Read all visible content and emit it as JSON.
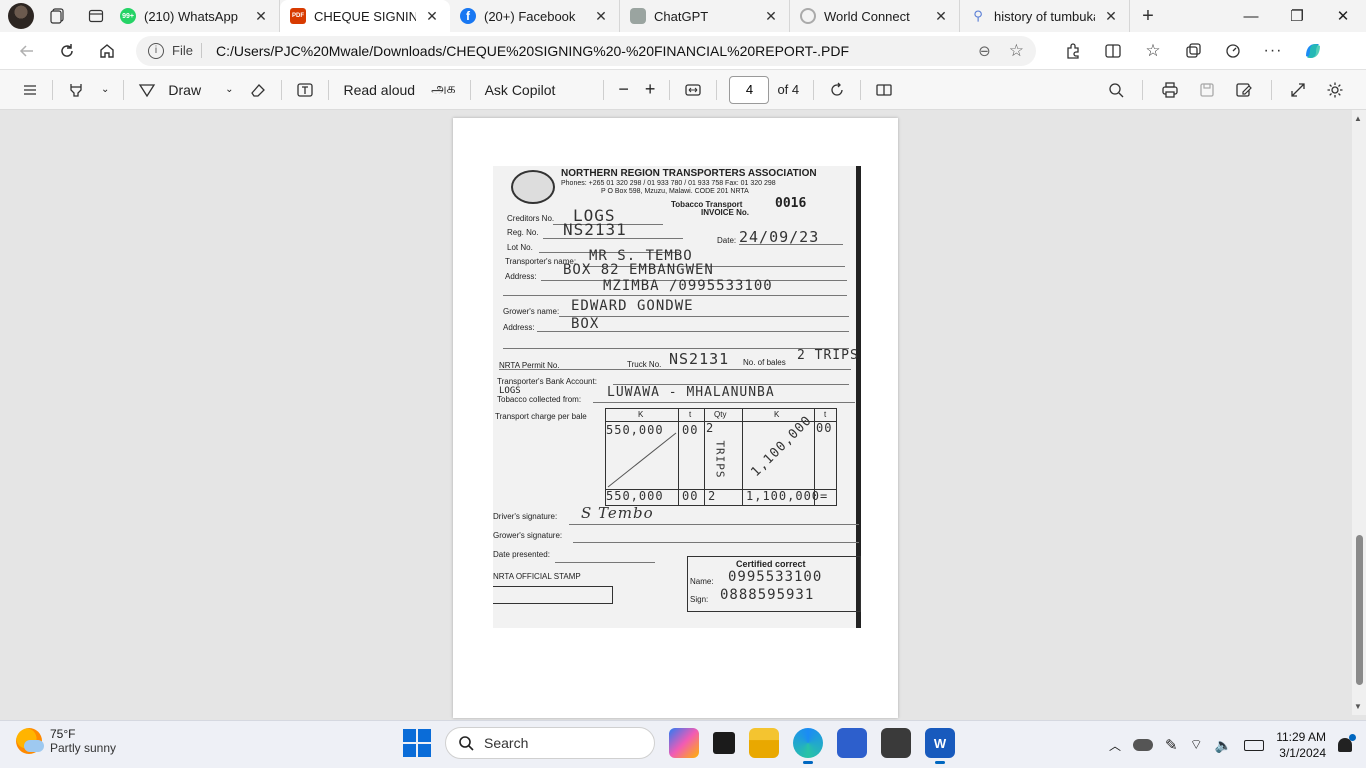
{
  "tabs": [
    {
      "title": "(210) WhatsApp",
      "favicon_text": "99+",
      "favicon_color": "#25d366",
      "active": false
    },
    {
      "title": "CHEQUE SIGNING -",
      "favicon_text": "PDF",
      "favicon_color": "#d83b01",
      "active": true
    },
    {
      "title": "(20+) Facebook",
      "favicon_text": "f",
      "favicon_color": "#1877f2",
      "active": false
    },
    {
      "title": "ChatGPT",
      "favicon_text": "",
      "favicon_color": "#9aa4a0",
      "active": false
    },
    {
      "title": "World Connect",
      "favicon_text": "",
      "favicon_color": "#cccccc",
      "active": false
    },
    {
      "title": "history of tumbukas",
      "favicon_text": "",
      "favicon_color": "#5b7fd6",
      "active": false
    }
  ],
  "address": {
    "file_label": "File",
    "url": "C:/Users/PJC%20Mwale/Downloads/CHEQUE%20SIGNING%20-%20FINANCIAL%20REPORT-.PDF"
  },
  "pdf_toolbar": {
    "draw_label": "Draw",
    "read_aloud_label": "Read aloud",
    "translate_label": "அக",
    "ask_copilot_label": "Ask Copilot",
    "current_page": "4",
    "total_pages_label": "of 4"
  },
  "document": {
    "org_name": "NORTHERN REGION TRANSPORTERS ASSOCIATION",
    "phones": "Phones: +265 01 320 298 / 01 933 780 / 01 933 758  Fax: 01 320 298",
    "po_box": "P O Box 598, Mzuzu, Malawi. CODE 201 NRTA",
    "invoice_title": "Tobacco Transport",
    "invoice_label": "INVOICE No.",
    "invoice_no": "0016",
    "creditors_label": "Creditors No.",
    "creditors_value": "LOGS",
    "reg_label": "Reg. No.",
    "reg_value": "NS2131",
    "lot_label": "Lot No.",
    "date_label": "Date:",
    "date_value": "24/09/23",
    "transporter_label": "Transporter's name:",
    "transporter_value": "MR  S.   TEMBO",
    "address_label": "Address:",
    "address_line1": "BOX 82  EMBANGWEN",
    "address_line2": "MZIMBA  /0995533100",
    "grower_label": "Grower's name:",
    "grower_value": "EDWARD  GONDWE",
    "grower_address_label": "Address:",
    "grower_address_value": "BOX",
    "permit_label": "NRTA Permit No.",
    "truck_label": "Truck No.",
    "truck_value": "NS2131",
    "bales_label": "No. of bales",
    "bales_value": "2 TRIPS",
    "bank_label": "Transporter's Bank Account:",
    "bank_value": "LOGS",
    "collected_label": "Tobacco collected from:",
    "collected_value": "LUWAWA  -  MHALANUNBA",
    "charge_label": "Transport charge per bale",
    "col_k": "K",
    "col_t": "t",
    "col_qty": "Qty",
    "col_k2": "K",
    "col_t2": "t",
    "row_k": "550,000",
    "row_t": "00",
    "row_qty": "2",
    "trips_vertical": "TRIPS",
    "row_total_diag": "1,100,000",
    "row_total_t": "00",
    "sum_k": "550,000",
    "sum_t": "00",
    "sum_qty": "2",
    "sum_total": "1,100,000=",
    "driver_sig_label": "Driver's signature:",
    "driver_sig_value": "S Tembo",
    "grower_sig_label": "Grower's signature:",
    "date_presented_label": "Date presented:",
    "stamp_label": "NRTA OFFICIAL STAMP",
    "certified_label": "Certified correct",
    "cert_name_label": "Name:",
    "cert_name_value": "0995533100",
    "cert_sign_label": "Sign:",
    "cert_sign_value": "0888595931"
  },
  "taskbar": {
    "temperature": "75°F",
    "condition": "Partly sunny",
    "search_placeholder": "Search",
    "time": "11:29 AM",
    "date": "3/1/2024"
  },
  "colors": {
    "accent": "#0067c0",
    "start_blue": "#0a6cd8"
  }
}
